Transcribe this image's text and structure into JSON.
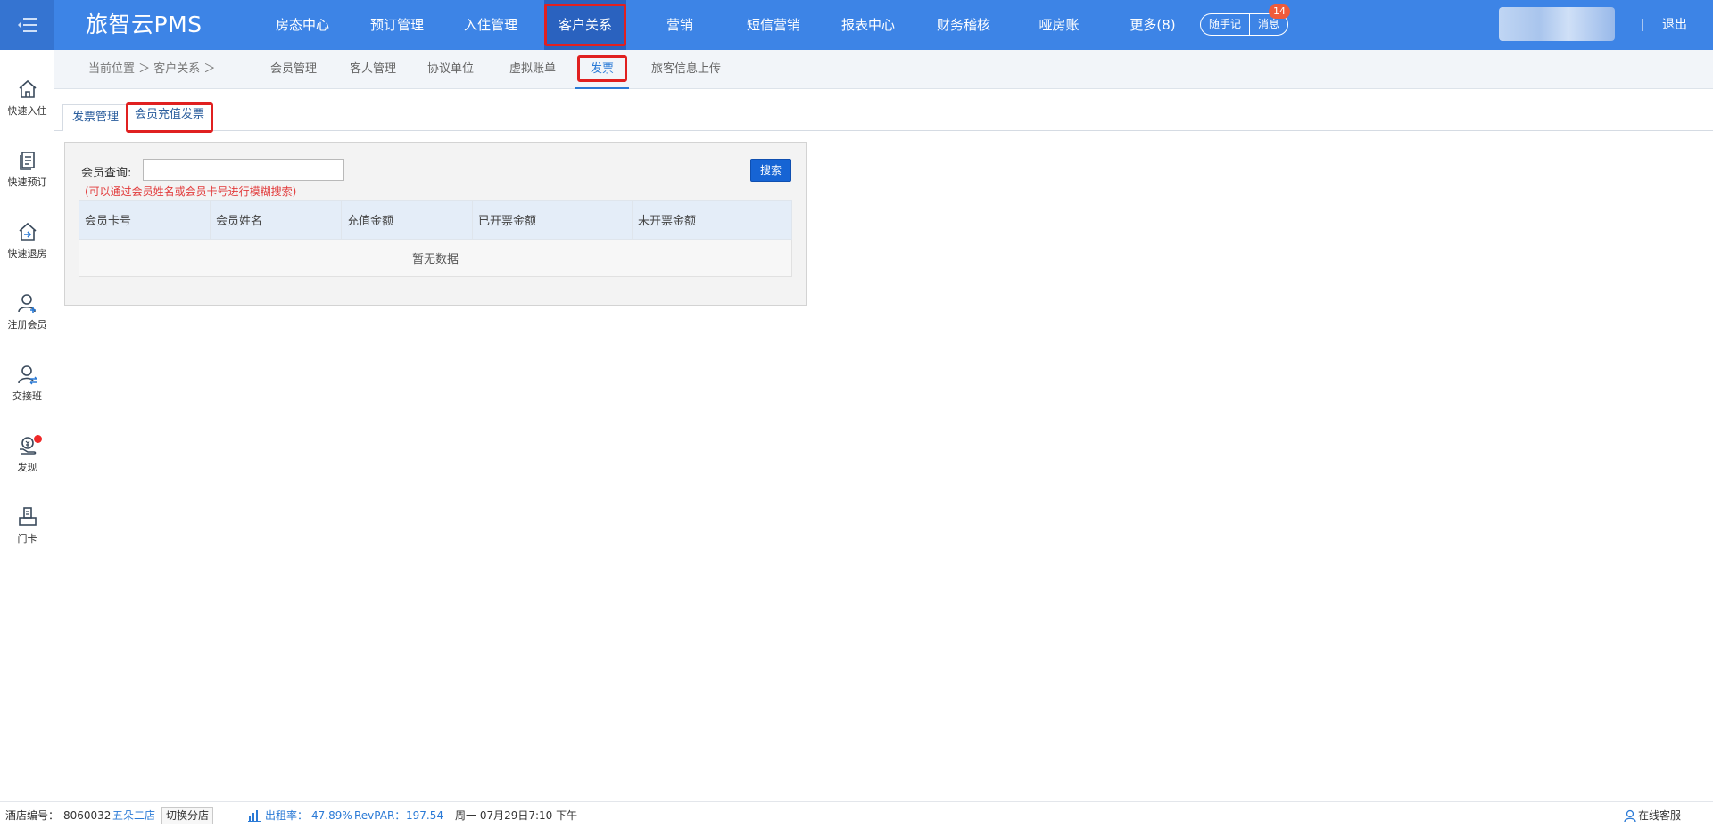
{
  "app": {
    "logo": "旅智云PMS"
  },
  "topnav": {
    "items": [
      "房态中心",
      "预订管理",
      "入住管理",
      "客户关系",
      "营销",
      "短信营销",
      "报表中心",
      "财务稽核",
      "哑房账",
      "更多(8)"
    ],
    "active_index": 3,
    "notes_label": "随手记",
    "messages_label": "消息",
    "messages_badge": "14",
    "logout_label": "退出"
  },
  "sidebar": {
    "items": [
      {
        "label": "快速入住",
        "icon": "home-icon"
      },
      {
        "label": "快速预订",
        "icon": "document-icon"
      },
      {
        "label": "快速退房",
        "icon": "checkout-icon"
      },
      {
        "label": "注册会员",
        "icon": "user-add-icon"
      },
      {
        "label": "交接班",
        "icon": "user-swap-icon"
      },
      {
        "label": "发现",
        "icon": "discover-icon"
      },
      {
        "label": "门卡",
        "icon": "card-icon"
      }
    ]
  },
  "subnav": {
    "breadcrumb": "当前位置 ＞ 客户关系 ＞",
    "items": [
      "会员管理",
      "客人管理",
      "协议单位",
      "虚拟账单",
      "发票",
      "旅客信息上传"
    ],
    "active_index": 4
  },
  "tabs": {
    "items": [
      "发票管理",
      "会员充值发票"
    ],
    "active_index": 1
  },
  "search": {
    "label": "会员查询:",
    "value": "",
    "hint": "(可以通过会员姓名或会员卡号进行模糊搜索)",
    "button_label": "搜索"
  },
  "table": {
    "columns": [
      "会员卡号",
      "会员姓名",
      "充值金额",
      "已开票金额",
      "未开票金额"
    ],
    "empty_text": "暂无数据"
  },
  "footer": {
    "hotel_no_label": "酒店编号：",
    "hotel_no": "8060032",
    "hotel_name": "五朵二店",
    "switch_label": "切换分店",
    "occupancy_label": "出租率：",
    "occupancy": "47.89%",
    "revpar_label": "RevPAR：",
    "revpar": "197.54",
    "datetime": "周一 07月29日7:10 下午",
    "support_label": "在线客服"
  },
  "colors": {
    "primary": "#3d84e6",
    "active_nav": "#2a62bf",
    "highlight": "#e02020",
    "link": "#2a7ad6"
  }
}
